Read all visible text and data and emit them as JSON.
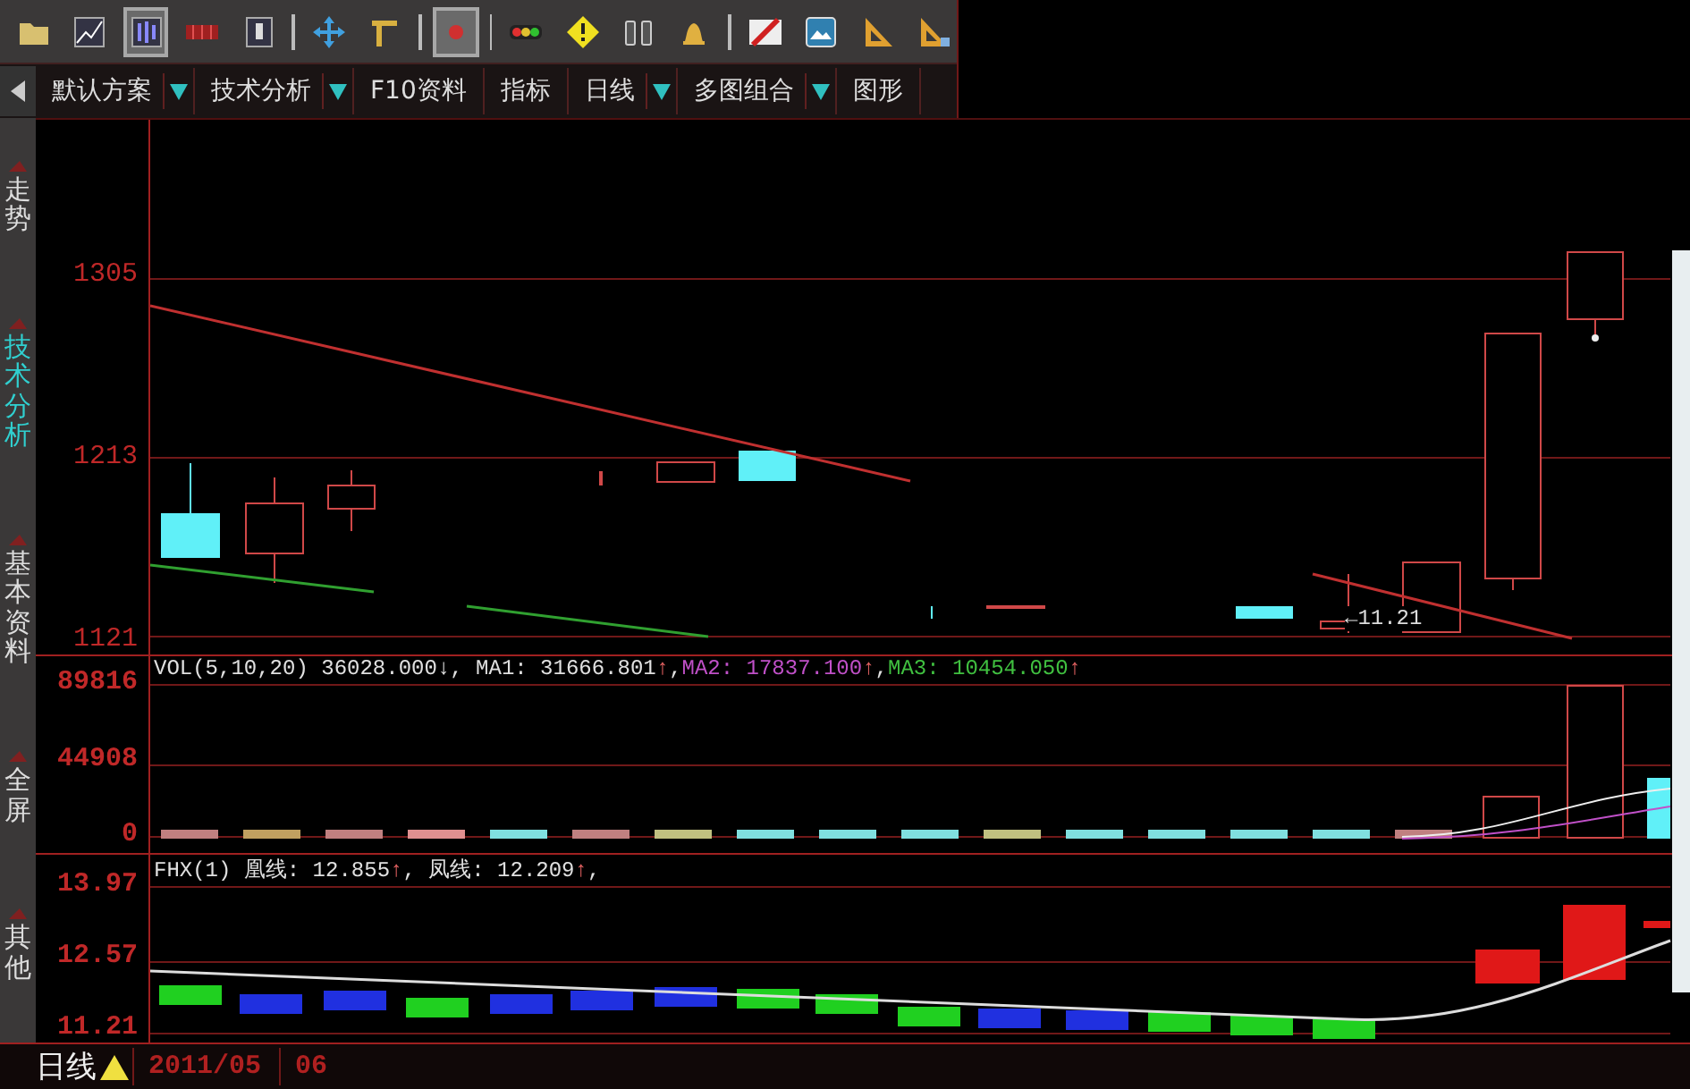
{
  "toolbar": [
    {
      "kind": "folder",
      "selected": false
    },
    {
      "kind": "line-chart",
      "selected": false
    },
    {
      "kind": "bar-chart",
      "selected": true
    },
    {
      "kind": "red-grid",
      "selected": false
    },
    {
      "kind": "portrait",
      "selected": false
    },
    {
      "kind": "separator"
    },
    {
      "kind": "move",
      "selected": false
    },
    {
      "kind": "tee",
      "selected": false
    },
    {
      "kind": "separator"
    },
    {
      "kind": "red-dot",
      "selected": true
    },
    {
      "kind": "separator"
    },
    {
      "kind": "traffic",
      "selected": false
    },
    {
      "kind": "warning",
      "selected": false
    },
    {
      "kind": "binoculars",
      "selected": false
    },
    {
      "kind": "bell",
      "selected": false
    },
    {
      "kind": "separator"
    },
    {
      "kind": "flag",
      "selected": false
    },
    {
      "kind": "picture",
      "selected": false
    },
    {
      "kind": "set-square",
      "selected": false
    },
    {
      "kind": "set-square-pen",
      "selected": false
    }
  ],
  "menu": {
    "items": [
      {
        "label": "默认方案",
        "dropdown": true
      },
      {
        "label": "技术分析",
        "dropdown": true
      },
      {
        "label": "F10资料",
        "dropdown": false
      },
      {
        "label": "指标",
        "dropdown": false
      },
      {
        "label": "日线",
        "dropdown": true
      },
      {
        "label": "多图组合",
        "dropdown": true
      },
      {
        "label": "图形",
        "dropdown": false
      }
    ]
  },
  "sidebar": {
    "items": [
      {
        "label": "走势",
        "selected": false
      },
      {
        "label": "技术分析",
        "selected": true
      },
      {
        "label": "基本资料",
        "selected": false
      },
      {
        "label": "全屏",
        "selected": false
      },
      {
        "label": "其他",
        "selected": false
      }
    ]
  },
  "main_chart": {
    "axis_labels": [
      "1305",
      "1213",
      "1121"
    ],
    "low_marker": "←11.21"
  },
  "volume_panel": {
    "axis_labels": [
      "89816",
      "44908",
      "0"
    ],
    "legend": [
      {
        "text": "VOL(5,10,20) 36028.000",
        "color": "#e0e0e0"
      },
      {
        "text": "↓",
        "color": "#e0e0e0"
      },
      {
        "text": ", MA1: 31666.801",
        "color": "#e0e0e0"
      },
      {
        "text": "↑",
        "color": "#e06060"
      },
      {
        "text": ",",
        "color": "#e0e0e0"
      },
      {
        "text": "MA2: 17837.100",
        "color": "#c050c8"
      },
      {
        "text": "↑",
        "color": "#e06060"
      },
      {
        "text": ",",
        "color": "#e0e0e0"
      },
      {
        "text": "MA3: 10454.050",
        "color": "#40c040"
      },
      {
        "text": "↑",
        "color": "#e06060"
      }
    ]
  },
  "indicator_panel": {
    "axis_labels": [
      "13.97",
      "12.57",
      "11.21"
    ],
    "legend": [
      {
        "text": "FHX(1) 凰线: 12.855",
        "color": "#e0e0e0"
      },
      {
        "text": "↑",
        "color": "#e06060"
      },
      {
        "text": ", 凤线: 12.209",
        "color": "#e0e0e0"
      },
      {
        "text": "↑",
        "color": "#e06060"
      },
      {
        "text": ",",
        "color": "#e0e0e0"
      }
    ]
  },
  "footer": {
    "period": "日线",
    "dates": [
      "2011/05",
      "06"
    ]
  }
}
